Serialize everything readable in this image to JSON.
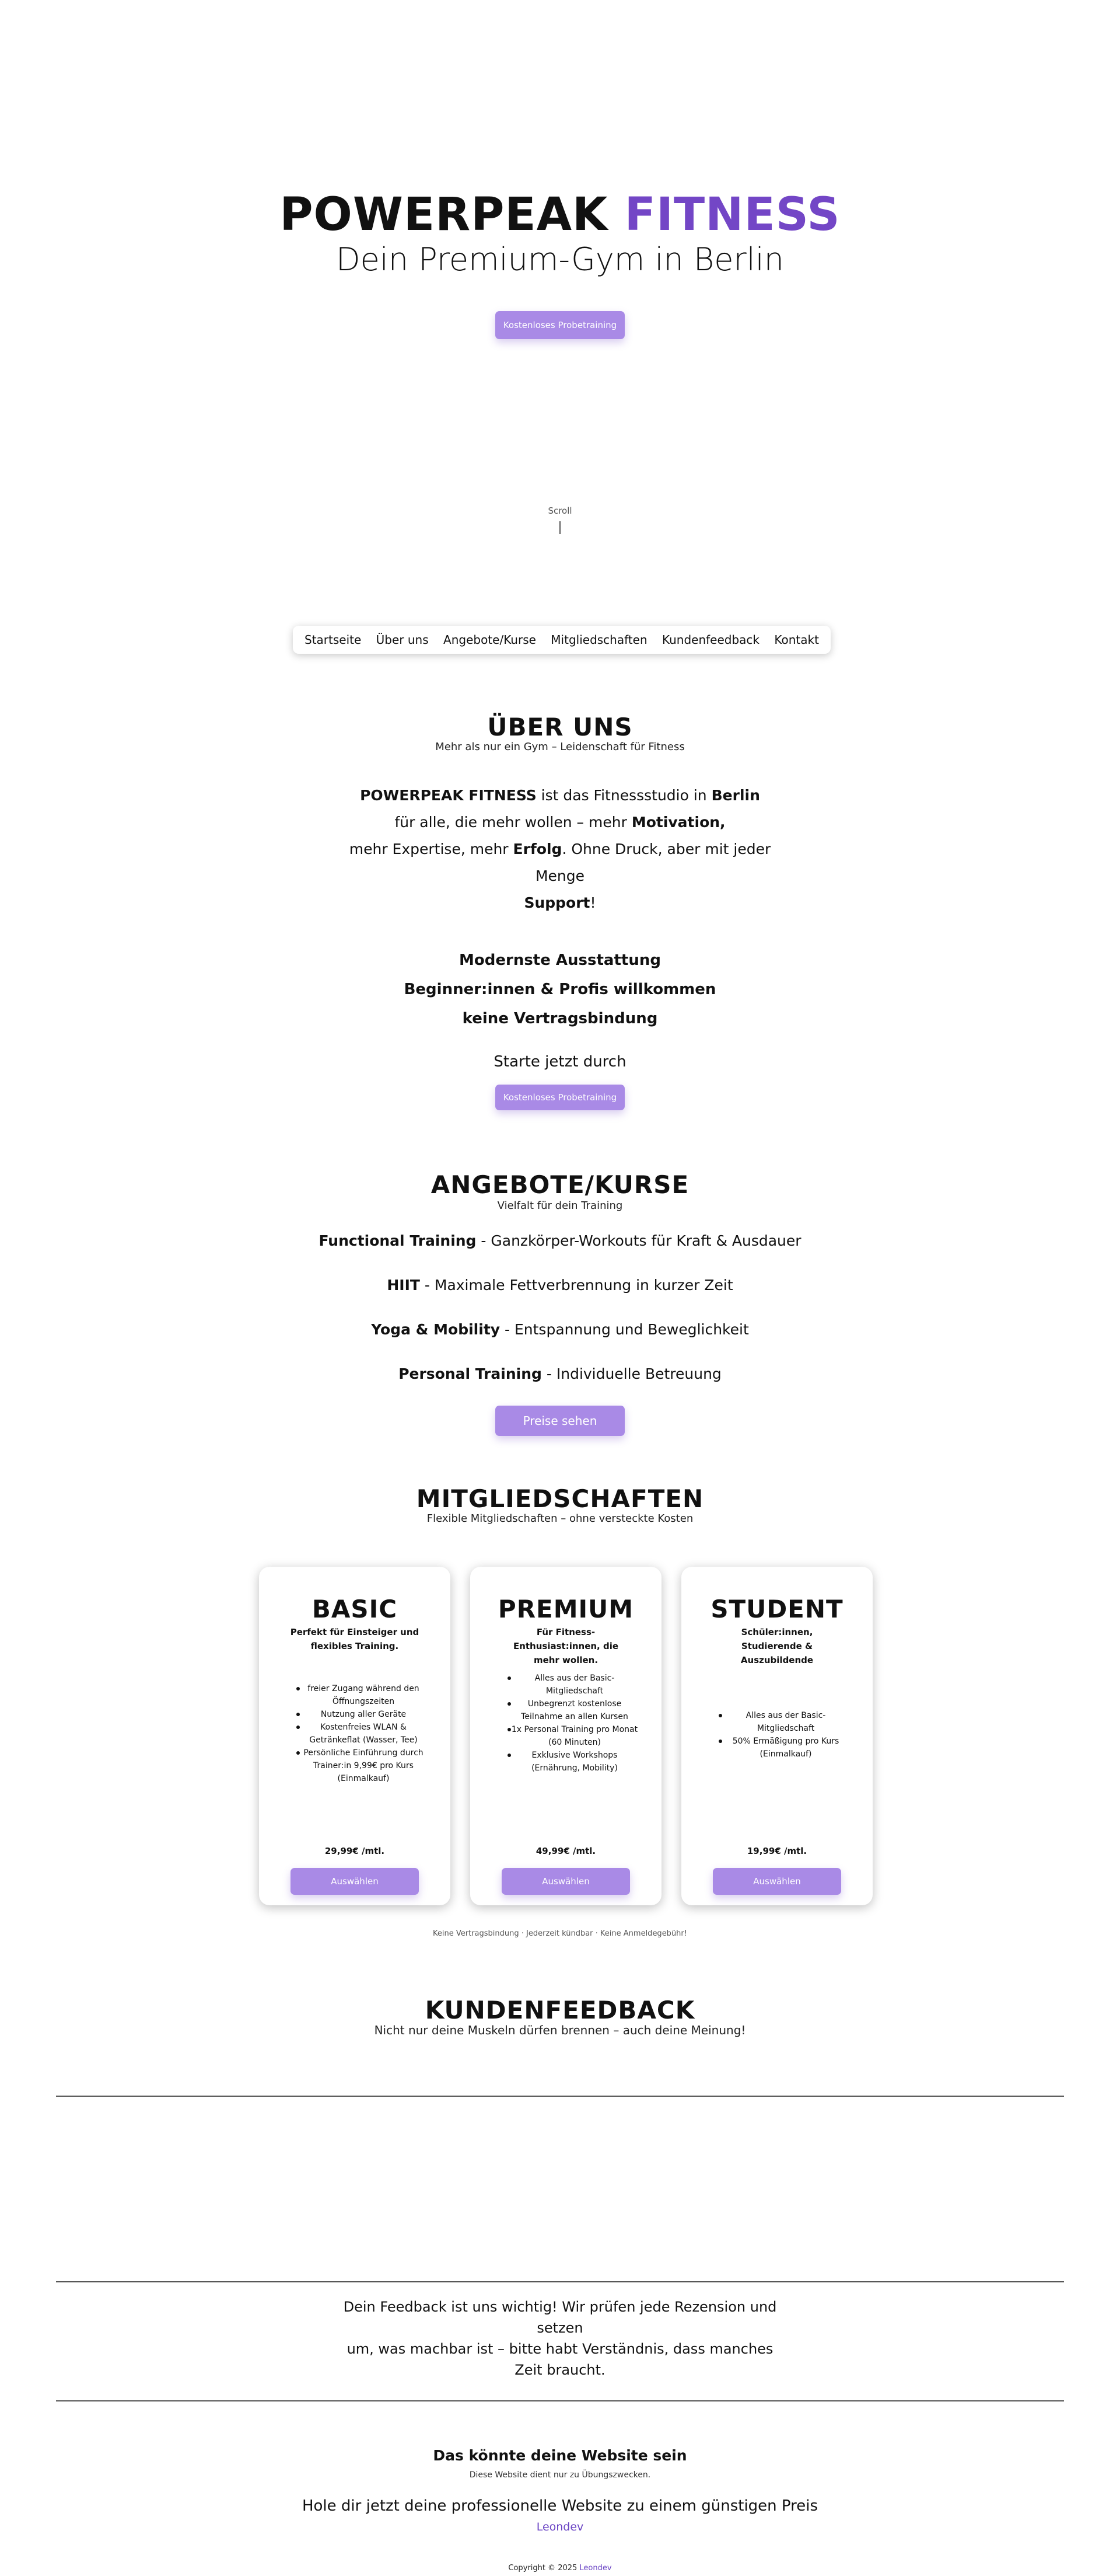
{
  "hero": {
    "title_main": "POWERPEAK",
    "title_accent": "FITNESS",
    "subtitle": "Dein Premium-Gym in Berlin",
    "cta_label": "Kostenloses Probetraining",
    "scroll_label": "Scroll"
  },
  "nav": {
    "items": [
      "Startseite",
      "Über uns",
      "Angebote/Kurse",
      "Mitgliedschaften",
      "Kundenfeedback",
      "Kontakt"
    ]
  },
  "about": {
    "title": "ÜBER UNS",
    "subtitle": "Mehr als nur ein Gym – Leidenschaft für Fitness",
    "brand": "POWERPEAK FITNESS",
    "text_1": " ist das Fitnessstudio in ",
    "city": "Berlin",
    "text_2": "für alle, die mehr wollen – mehr ",
    "word_motivation": "Motivation,",
    "text_3": "mehr Expertise, mehr ",
    "word_erfolg": "Erfolg",
    "text_4": ". Ohne Druck, aber mit jeder Menge",
    "word_support": "Support",
    "text_5": "!",
    "features": [
      "Modernste Ausstattung",
      "Beginner:innen & Profis willkommen",
      "keine Vertragsbindung"
    ],
    "cta_text": "Starte jetzt durch",
    "cta_label": "Kostenloses Probetraining"
  },
  "offers": {
    "title": "ANGEBOTE/KURSE",
    "subtitle": "Vielfalt für dein Training",
    "items": [
      {
        "name": "Functional Training",
        "desc": " - Ganzkörper-Workouts für Kraft & Ausdauer"
      },
      {
        "name": "HIIT",
        "desc": " - Maximale Fettverbrennung in kurzer Zeit"
      },
      {
        "name": "Yoga & Mobility",
        "desc": " - Entspannung und Beweglichkeit"
      },
      {
        "name": "Personal Training",
        "desc": " - Individuelle Betreuung"
      }
    ],
    "cta_label": "Preise sehen"
  },
  "memberships": {
    "title": "MITGLIEDSCHAFTEN",
    "subtitle": "Flexible Mitgliedschaften – ohne versteckte Kosten",
    "plans": [
      {
        "name": "BASIC",
        "desc": "Perfekt für Einsteiger und flexibles Training.",
        "features": [
          "freier Zugang während den Öffnungszeiten",
          "Nutzung aller Geräte",
          "Kostenfreies WLAN & Getränkeflat (Wasser, Tee)",
          "Persönliche Einführung durch Trainer:in 9,99€ pro Kurs (Einmalkauf)"
        ],
        "price": "29,99€ /mtl.",
        "button": "Auswählen"
      },
      {
        "name": "PREMIUM",
        "desc": "Für Fitness-Enthusiast:innen, die mehr wollen.",
        "features": [
          "Alles aus der Basic-Mitgliedschaft",
          "Unbegrenzt kostenlose Teilnahme an allen Kursen",
          "1x Personal Training pro Monat (60 Minuten)",
          "Exklusive Workshops (Ernährung, Mobility)"
        ],
        "price": "49,99€ /mtl.",
        "button": "Auswählen"
      },
      {
        "name": "STUDENT",
        "desc": "Schüler:innen, Studierende & Auszubildende",
        "features": [
          "Alles aus der Basic-Mitgliedschaft",
          "50% Ermäßigung pro Kurs (Einmalkauf)"
        ],
        "price": "19,99€ /mtl.",
        "button": "Auswählen"
      }
    ],
    "note": "Keine Vertragsbindung · Jederzeit kündbar · Keine Anmeldegebühr!"
  },
  "feedback": {
    "title": "KUNDENFEEDBACK",
    "subtitle": "Nicht nur deine Muskeln dürfen brennen – auch deine Meinung!",
    "note_1": "Dein Feedback ist uns wichtig! Wir prüfen jede Rezension und setzen",
    "note_2": "um, was machbar ist – bitte habt Verständnis, dass manches",
    "note_3": "Zeit braucht."
  },
  "footer": {
    "title": "Das könnte deine Website sein",
    "subtitle": "Diese Website dient nur zu Übungszwecken.",
    "cta": "Hole dir jetzt deine professionelle Website zu einem günstigen Preis",
    "link": "Leondev",
    "copyright": "Copyright © 2025 ",
    "copyright_link": "Leondev"
  },
  "colors": {
    "accent": "#7346c6",
    "button": "#a98ae6",
    "link": "#6a44c4"
  }
}
